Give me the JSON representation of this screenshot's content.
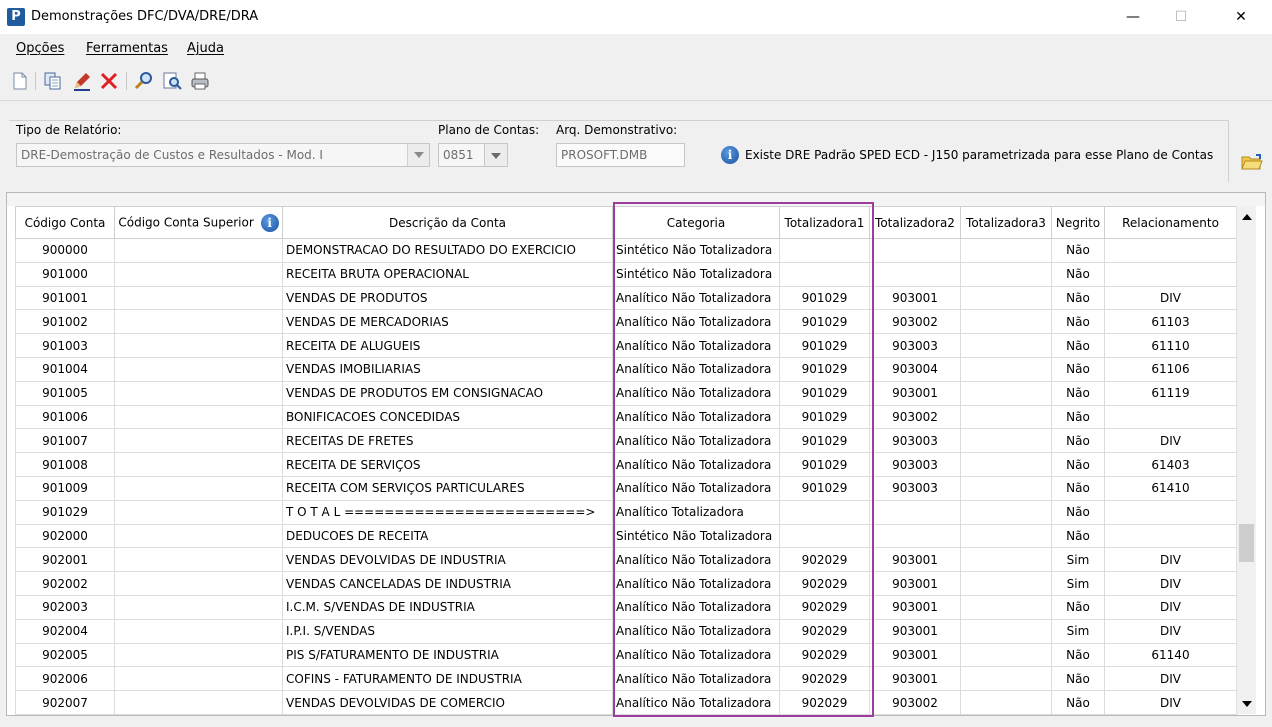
{
  "window": {
    "app_icon_letter": "P",
    "title": "Demonstrações DFC/DVA/DRE/DRA",
    "minimize_glyph": "—",
    "maximize_glyph": "☐",
    "close_glyph": "✕"
  },
  "menu": [
    "Opções",
    "Ferramentas",
    "Ajuda"
  ],
  "toolbar": {
    "icons": [
      "new-document-icon",
      "copy-icon",
      "edit-pencil-icon",
      "delete-x-icon",
      "search-icon",
      "search-zoom-icon",
      "print-icon"
    ]
  },
  "params": {
    "report_type_label": "Tipo de Relatório:",
    "report_type_value": "DRE-Demostração de Custos e Resultados - Mod. I",
    "chart_label": "Plano de Contas:",
    "chart_value": "0851",
    "file_label": "Arq. Demonstrativo:",
    "file_value": "PROSOFT.DMB",
    "info_glyph": "i",
    "info_text": "Existe DRE Padrão SPED ECD - J150 parametrizada para esse Plano de Contas"
  },
  "grid": {
    "columns": [
      "Código Conta",
      "Código Conta Superior",
      "Descrição da Conta",
      "Categoria",
      "Totalizadora1",
      "Totalizadora2",
      "Totalizadora3",
      "Negrito",
      "Relacionamento"
    ],
    "rows": [
      [
        "900000",
        "",
        "DEMONSTRACAO DO RESULTADO DO EXERCICIO",
        "Sintético Não Totalizadora",
        "",
        "",
        "",
        "Não",
        ""
      ],
      [
        "901000",
        "",
        "RECEITA BRUTA OPERACIONAL",
        "Sintético Não Totalizadora",
        "",
        "",
        "",
        "Não",
        ""
      ],
      [
        "901001",
        "",
        "VENDAS DE PRODUTOS",
        "Analítico Não Totalizadora",
        "901029",
        "903001",
        "",
        "Não",
        "DIV"
      ],
      [
        "901002",
        "",
        "VENDAS DE MERCADORIAS",
        "Analítico Não Totalizadora",
        "901029",
        "903002",
        "",
        "Não",
        "61103"
      ],
      [
        "901003",
        "",
        "RECEITA DE ALUGUEIS",
        "Analítico Não Totalizadora",
        "901029",
        "903003",
        "",
        "Não",
        "61110"
      ],
      [
        "901004",
        "",
        "VENDAS IMOBILIARIAS",
        "Analítico Não Totalizadora",
        "901029",
        "903004",
        "",
        "Não",
        "61106"
      ],
      [
        "901005",
        "",
        "VENDAS DE PRODUTOS EM CONSIGNACAO",
        "Analítico Não Totalizadora",
        "901029",
        "903001",
        "",
        "Não",
        "61119"
      ],
      [
        "901006",
        "",
        "BONIFICACOES CONCEDIDAS",
        "Analítico Não Totalizadora",
        "901029",
        "903002",
        "",
        "Não",
        ""
      ],
      [
        "901007",
        "",
        "RECEITAS DE FRETES",
        "Analítico Não Totalizadora",
        "901029",
        "903003",
        "",
        "Não",
        "DIV"
      ],
      [
        "901008",
        "",
        "RECEITA DE SERVIÇOS",
        "Analítico Não Totalizadora",
        "901029",
        "903003",
        "",
        "Não",
        "61403"
      ],
      [
        "901009",
        "",
        "RECEITA COM SERVIÇOS PARTICULARES",
        "Analítico Não Totalizadora",
        "901029",
        "903003",
        "",
        "Não",
        "61410"
      ],
      [
        "901029",
        "",
        "T O T A L ========================>",
        "Analítico Totalizadora",
        "",
        "",
        "",
        "Não",
        ""
      ],
      [
        "902000",
        "",
        "DEDUCOES DE RECEITA",
        "Sintético Não Totalizadora",
        "",
        "",
        "",
        "Não",
        ""
      ],
      [
        "902001",
        "",
        "VENDAS DEVOLVIDAS DE INDUSTRIA",
        "Analítico Não Totalizadora",
        "902029",
        "903001",
        "",
        "Sim",
        "DIV"
      ],
      [
        "902002",
        "",
        "VENDAS CANCELADAS DE INDUSTRIA",
        "Analítico Não Totalizadora",
        "902029",
        "903001",
        "",
        "Sim",
        "DIV"
      ],
      [
        "902003",
        "",
        "I.C.M. S/VENDAS DE INDUSTRIA",
        "Analítico Não Totalizadora",
        "902029",
        "903001",
        "",
        "Não",
        "DIV"
      ],
      [
        "902004",
        "",
        "I.P.I. S/VENDAS",
        "Analítico Não Totalizadora",
        "902029",
        "903001",
        "",
        "Sim",
        "DIV"
      ],
      [
        "902005",
        "",
        "PIS S/FATURAMENTO DE INDUSTRIA",
        "Analítico Não Totalizadora",
        "902029",
        "903001",
        "",
        "Não",
        "61140"
      ],
      [
        "902006",
        "",
        "COFINS - FATURAMENTO DE INDUSTRIA",
        "Analítico Não Totalizadora",
        "902029",
        "903001",
        "",
        "Não",
        "DIV"
      ],
      [
        "902007",
        "",
        "VENDAS DEVOLVIDAS DE COMERCIO",
        "Analítico Não Totalizadora",
        "902029",
        "903002",
        "",
        "Não",
        "DIV"
      ]
    ]
  },
  "colors": {
    "highlight": "#9c3d9e",
    "app_icon": "#1f5c9e"
  }
}
